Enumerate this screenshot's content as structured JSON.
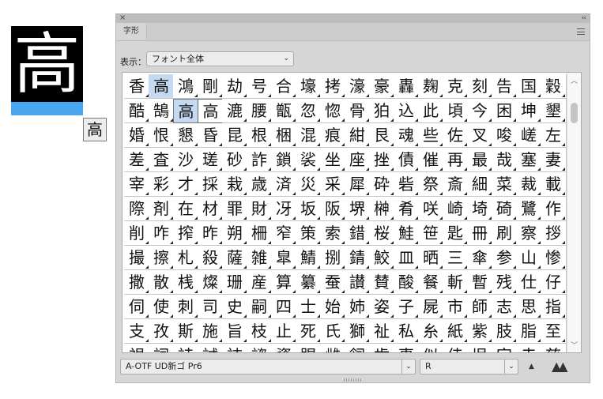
{
  "preview": {
    "glyph": "高",
    "small_glyph": "高"
  },
  "panel": {
    "close": "×",
    "collapse": "‹‹",
    "tab_label": "字形",
    "show_label": "表示：",
    "show_value": "フォント全体",
    "font_family": "A-OTF UD新ゴ Pr6",
    "font_style": "R"
  },
  "popup": {
    "cells": [
      "高",
      "高"
    ]
  },
  "grid": {
    "rows": [
      "香高鴻剛劫号合壕拷濠豪轟麹克刻告国穀",
      "酷鵠高高漉腰甑忽惚骨狛込此頃今困坤墾",
      "婚恨懇昏昆根梱混痕紺艮魂些佐叉唆嵯左",
      "差査沙瑳砂詐鎖裟坐座挫債催再最哉塞妻",
      "宰彩才採栽歳済災采犀砕砦祭斎細菜裁載",
      "際剤在材罪財冴坂阪堺榊肴咲崎埼碕鷺作",
      "削咋搾昨朔柵窄策索錯桜鮭笹匙冊刷察拶",
      "撮擦札殺薩雑皐鯖捌錆鮫皿晒三傘参山惨",
      "撒散桟燦珊産算纂蚕讃賛酸餐斬暫残仕仔",
      "伺使刺司史嗣四士始姉姿子屍市師志思指",
      "支孜斯施旨枝止死氏獅祉私糸紙紫肢脂至",
      "視詞詩試誌諮資賜雌飼歯事似侍児字寺慈"
    ]
  }
}
